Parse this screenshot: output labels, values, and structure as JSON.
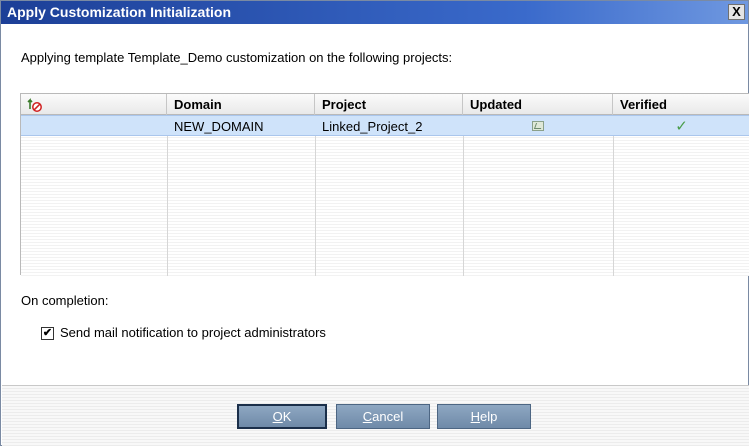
{
  "window": {
    "title": "Apply Customization Initialization",
    "close_label": "X"
  },
  "intro_text": "Applying template Template_Demo customization on the following projects:",
  "grid": {
    "columns": [
      "",
      "Domain",
      "Project",
      "Updated",
      "Verified"
    ],
    "rows": [
      {
        "domain": "NEW_DOMAIN",
        "project": "Linked_Project_2",
        "updated_icon": "updated-table-icon",
        "verified": "✓",
        "selected": true
      }
    ],
    "header_icon": "sync-cancel-icon"
  },
  "completion": {
    "label": "On completion:",
    "send_mail": {
      "label": "Send mail notification to project administrators",
      "checked": true,
      "check_glyph": "✔"
    }
  },
  "buttons": {
    "ok": {
      "mnemonic": "O",
      "rest": "K"
    },
    "cancel": {
      "mnemonic": "C",
      "rest": "ancel"
    },
    "help": {
      "mnemonic": "H",
      "rest": "elp"
    }
  },
  "colors": {
    "title_bar": "#1c3f97",
    "selection": "#cfe3fa",
    "button": "#7b94b1",
    "verified_check": "#4a9d4a"
  }
}
